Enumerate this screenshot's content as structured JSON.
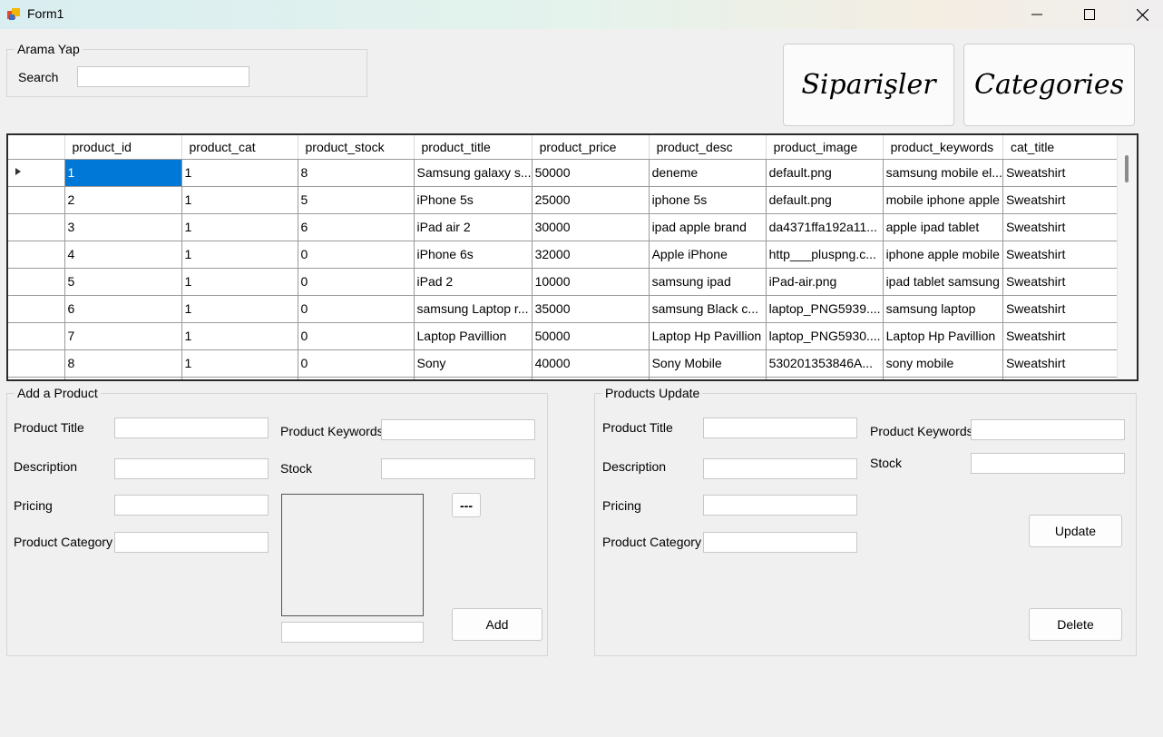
{
  "window": {
    "title": "Form1"
  },
  "search_group": {
    "title": "Arama Yap",
    "search_label": "Search",
    "search_value": ""
  },
  "buttons": {
    "orders": "Siparişler",
    "categories": "Categories"
  },
  "grid": {
    "columns": [
      "product_id",
      "product_cat",
      "product_stock",
      "product_title",
      "product_price",
      "product_desc",
      "product_image",
      "product_keywords",
      "cat_title"
    ],
    "rows": [
      [
        "1",
        "1",
        "8",
        "Samsung galaxy s...",
        "50000",
        "deneme",
        "default.png",
        "samsung mobile el...",
        "Sweatshirt"
      ],
      [
        "2",
        "1",
        "5",
        "iPhone 5s",
        "25000",
        "iphone 5s",
        "default.png",
        "mobile iphone apple",
        "Sweatshirt"
      ],
      [
        "3",
        "1",
        "6",
        "iPad air 2",
        "30000",
        "ipad apple brand",
        "da4371ffa192a11...",
        "apple ipad tablet",
        "Sweatshirt"
      ],
      [
        "4",
        "1",
        "0",
        "iPhone 6s",
        "32000",
        "Apple iPhone",
        "http___pluspng.c...",
        "iphone apple mobile",
        "Sweatshirt"
      ],
      [
        "5",
        "1",
        "0",
        "iPad 2",
        "10000",
        "samsung ipad",
        "iPad-air.png",
        "ipad tablet samsung",
        "Sweatshirt"
      ],
      [
        "6",
        "1",
        "0",
        "samsung Laptop r...",
        "35000",
        "samsung Black c...",
        "laptop_PNG5939....",
        "samsung laptop",
        "Sweatshirt"
      ],
      [
        "7",
        "1",
        "0",
        "Laptop Pavillion",
        "50000",
        "Laptop Hp Pavillion",
        "laptop_PNG5930....",
        "Laptop Hp Pavillion",
        "Sweatshirt"
      ],
      [
        "8",
        "1",
        "0",
        "Sony",
        "40000",
        "Sony Mobile",
        "530201353846A...",
        "sony mobile",
        "Sweatshirt"
      ]
    ]
  },
  "add_group": {
    "title": "Add a Product",
    "product_title_label": "Product Title",
    "description_label": "Description",
    "pricing_label": "Pricing",
    "category_label": "Product Category",
    "keywords_label": "Product Keywords",
    "stock_label": "Stock",
    "browse_button": "---",
    "add_button": "Add"
  },
  "update_group": {
    "title": "Products Update",
    "product_title_label": "Product Title",
    "description_label": "Description",
    "pricing_label": "Pricing",
    "category_label": "Product Category",
    "keywords_label": "Product Keywords",
    "stock_label": "Stock",
    "update_button": "Update",
    "delete_button": "Delete"
  },
  "colors": {
    "selection": "#0078d7",
    "background": "#f0f0f0"
  }
}
